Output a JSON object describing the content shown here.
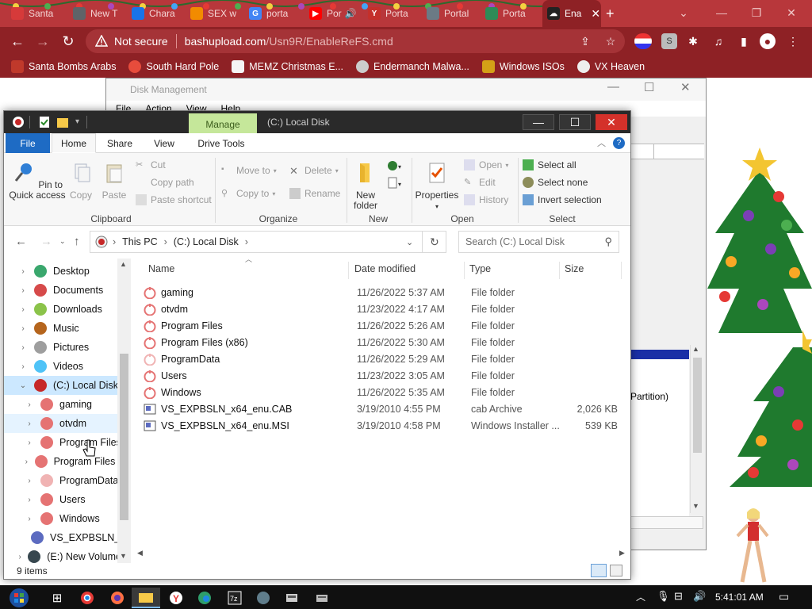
{
  "browser": {
    "tabs": [
      {
        "label": "Santa",
        "color": "#d63a3a"
      },
      {
        "label": "New T",
        "color": "#5f6368"
      },
      {
        "label": "Chara",
        "color": "#1a73e8"
      },
      {
        "label": "SEX w",
        "color": "#f28b00"
      },
      {
        "label": "porta",
        "color": "#4285f4"
      },
      {
        "label": "Por",
        "color": "#ff0000"
      },
      {
        "label": "Porta",
        "color": "#c4302b"
      },
      {
        "label": "Portal",
        "color": "#6b7a85"
      },
      {
        "label": "Porta",
        "color": "#2e8b57"
      },
      {
        "label": "Ena",
        "color": "#222222"
      }
    ],
    "url_warning": "Not secure",
    "url_domain": "bashupload.com",
    "url_path": "/Usn9R/EnableReFS.cmd",
    "bookmarks": [
      "Santa Bombs Arabs",
      "South Hard Pole",
      "MEMZ Christmas E...",
      "Endermanch Malwa...",
      "Windows ISOs",
      "VX Heaven"
    ]
  },
  "disk_management": {
    "title": "Disk Management",
    "menu": [
      "File",
      "Action",
      "View",
      "Help"
    ],
    "partition_label": "Partition)"
  },
  "explorer": {
    "manage_tab": "Manage",
    "window_title": "(C:) Local Disk",
    "ribbon_tabs": [
      "File",
      "Home",
      "Share",
      "View",
      "Drive Tools"
    ],
    "clipboard": {
      "pin": "Pin to Quick access",
      "copy": "Copy",
      "paste": "Paste",
      "cut": "Cut",
      "copy_path": "Copy path",
      "paste_shortcut": "Paste shortcut",
      "group": "Clipboard"
    },
    "organize": {
      "move_to": "Move to",
      "copy_to": "Copy to",
      "delete": "Delete",
      "rename": "Rename",
      "group": "Organize"
    },
    "new": {
      "new_folder": "New folder",
      "group": "New"
    },
    "open": {
      "properties": "Properties",
      "open": "Open",
      "edit": "Edit",
      "history": "History",
      "group": "Open"
    },
    "select": {
      "select_all": "Select all",
      "select_none": "Select none",
      "invert": "Invert selection",
      "group": "Select"
    },
    "breadcrumb": [
      "This PC",
      "(C:) Local Disk"
    ],
    "search_placeholder": "Search (C:) Local Disk",
    "columns": {
      "name": "Name",
      "date": "Date modified",
      "type": "Type",
      "size": "Size"
    },
    "files": [
      {
        "name": "gaming",
        "date": "11/26/2022 5:37 AM",
        "type": "File folder",
        "size": "",
        "kind": "folder"
      },
      {
        "name": "otvdm",
        "date": "11/23/2022 4:17 AM",
        "type": "File folder",
        "size": "",
        "kind": "folder"
      },
      {
        "name": "Program Files",
        "date": "11/26/2022 5:26 AM",
        "type": "File folder",
        "size": "",
        "kind": "folder"
      },
      {
        "name": "Program Files (x86)",
        "date": "11/26/2022 5:30 AM",
        "type": "File folder",
        "size": "",
        "kind": "folder"
      },
      {
        "name": "ProgramData",
        "date": "11/26/2022 5:29 AM",
        "type": "File folder",
        "size": "",
        "kind": "folder-light"
      },
      {
        "name": "Users",
        "date": "11/23/2022 3:05 AM",
        "type": "File folder",
        "size": "",
        "kind": "folder"
      },
      {
        "name": "Windows",
        "date": "11/26/2022 5:35 AM",
        "type": "File folder",
        "size": "",
        "kind": "folder"
      },
      {
        "name": "VS_EXPBSLN_x64_enu.CAB",
        "date": "3/19/2010 4:55 PM",
        "type": "cab Archive",
        "size": "2,026 KB",
        "kind": "cab"
      },
      {
        "name": "VS_EXPBSLN_x64_enu.MSI",
        "date": "3/19/2010 4:58 PM",
        "type": "Windows Installer ...",
        "size": "539 KB",
        "kind": "msi"
      }
    ],
    "nav_items": [
      {
        "label": "Desktop",
        "level": 1,
        "icon": "#3aa76d"
      },
      {
        "label": "Documents",
        "level": 1,
        "icon": "#d64a4a"
      },
      {
        "label": "Downloads",
        "level": 1,
        "icon": "#8bc34a"
      },
      {
        "label": "Music",
        "level": 1,
        "icon": "#b5651d"
      },
      {
        "label": "Pictures",
        "level": 1,
        "icon": "#9e9e9e"
      },
      {
        "label": "Videos",
        "level": 1,
        "icon": "#4fc3f7"
      },
      {
        "label": "(C:) Local Disk",
        "level": 1,
        "icon": "#c62828"
      },
      {
        "label": "gaming",
        "level": 2,
        "icon": "#e57373"
      },
      {
        "label": "otvdm",
        "level": 2,
        "icon": "#e57373"
      },
      {
        "label": "Program Files",
        "level": 2,
        "icon": "#e57373"
      },
      {
        "label": "Program Files (",
        "level": 2,
        "icon": "#e57373"
      },
      {
        "label": "ProgramData",
        "level": 2,
        "icon": "#f0b3b3"
      },
      {
        "label": "Users",
        "level": 2,
        "icon": "#e57373"
      },
      {
        "label": "Windows",
        "level": 2,
        "icon": "#e57373"
      },
      {
        "label": "VS_EXPBSLN_x",
        "level": 2,
        "icon": "#5c6bc0"
      },
      {
        "label": "(E:) New Volume",
        "level": 1,
        "icon": "#37474f"
      }
    ],
    "status": "9 items"
  },
  "taskbar": {
    "time": "5:41:01 AM"
  },
  "colors": {
    "chrome_red": "#8e2125",
    "file_tab": "#1e6bc4",
    "manage_tab": "#c5e79a"
  }
}
